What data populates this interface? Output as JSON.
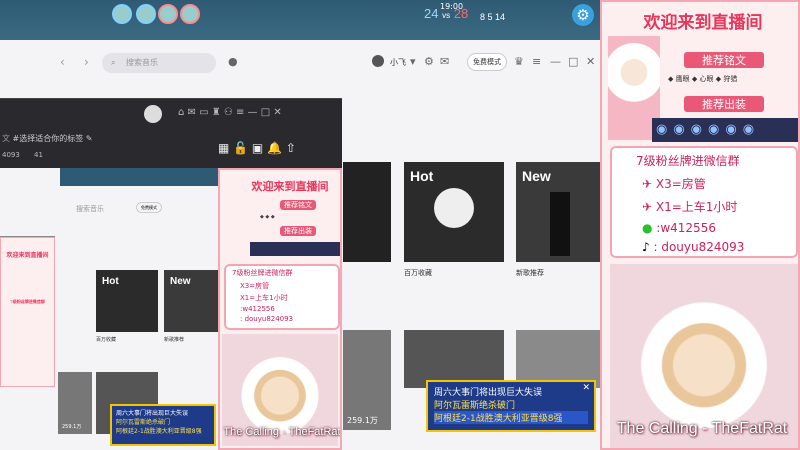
{
  "hud": {
    "score_blue": "24",
    "score_vs": "vs",
    "score_red": "28",
    "time": "19:00",
    "stats": "8  5  14"
  },
  "music": {
    "search_placeholder": "搜索音乐",
    "user": "小飞",
    "mode_btn": "免费模式",
    "tiles": [
      {
        "tag": "Hot",
        "caption": "百万收藏"
      },
      {
        "tag": "New",
        "caption": "新歌推荐"
      }
    ],
    "play_count": "259.1万"
  },
  "dark_window": {
    "tag_text": "#选择适合你的标签",
    "count_a": "4093",
    "count_b": "41"
  },
  "nested": {
    "search_placeholder": "搜索音乐",
    "user": "小飞",
    "mode_btn": "免费模式",
    "caption_a": "百万收藏",
    "caption_b": "新歌推荐",
    "play_count": "259.1万"
  },
  "overlay": {
    "welcome": "欢迎来到直播间",
    "runes_label": "推荐铭文",
    "runes": [
      "鹰眼",
      "心眼",
      "狩猎"
    ],
    "gear_label": "推荐出装",
    "fan_title": "7级粉丝牌进微信群",
    "rules": [
      {
        "k": "X3=房管"
      },
      {
        "k": "X1=上车1小时"
      }
    ],
    "wechat": ":w412556",
    "douyin": ": douyu824093"
  },
  "song": "The Calling - TheFatRat",
  "news": {
    "line1": "周六大事门将出现巨大失误",
    "line2": "阿尔瓦雷斯绝杀破门",
    "line3": "阿根廷2-1战胜澳大利亚晋级8强"
  },
  "colors": {
    "accent": "#e9365a",
    "panel_bg": "#fdeef0",
    "hud_bg": "#2f5a74"
  }
}
